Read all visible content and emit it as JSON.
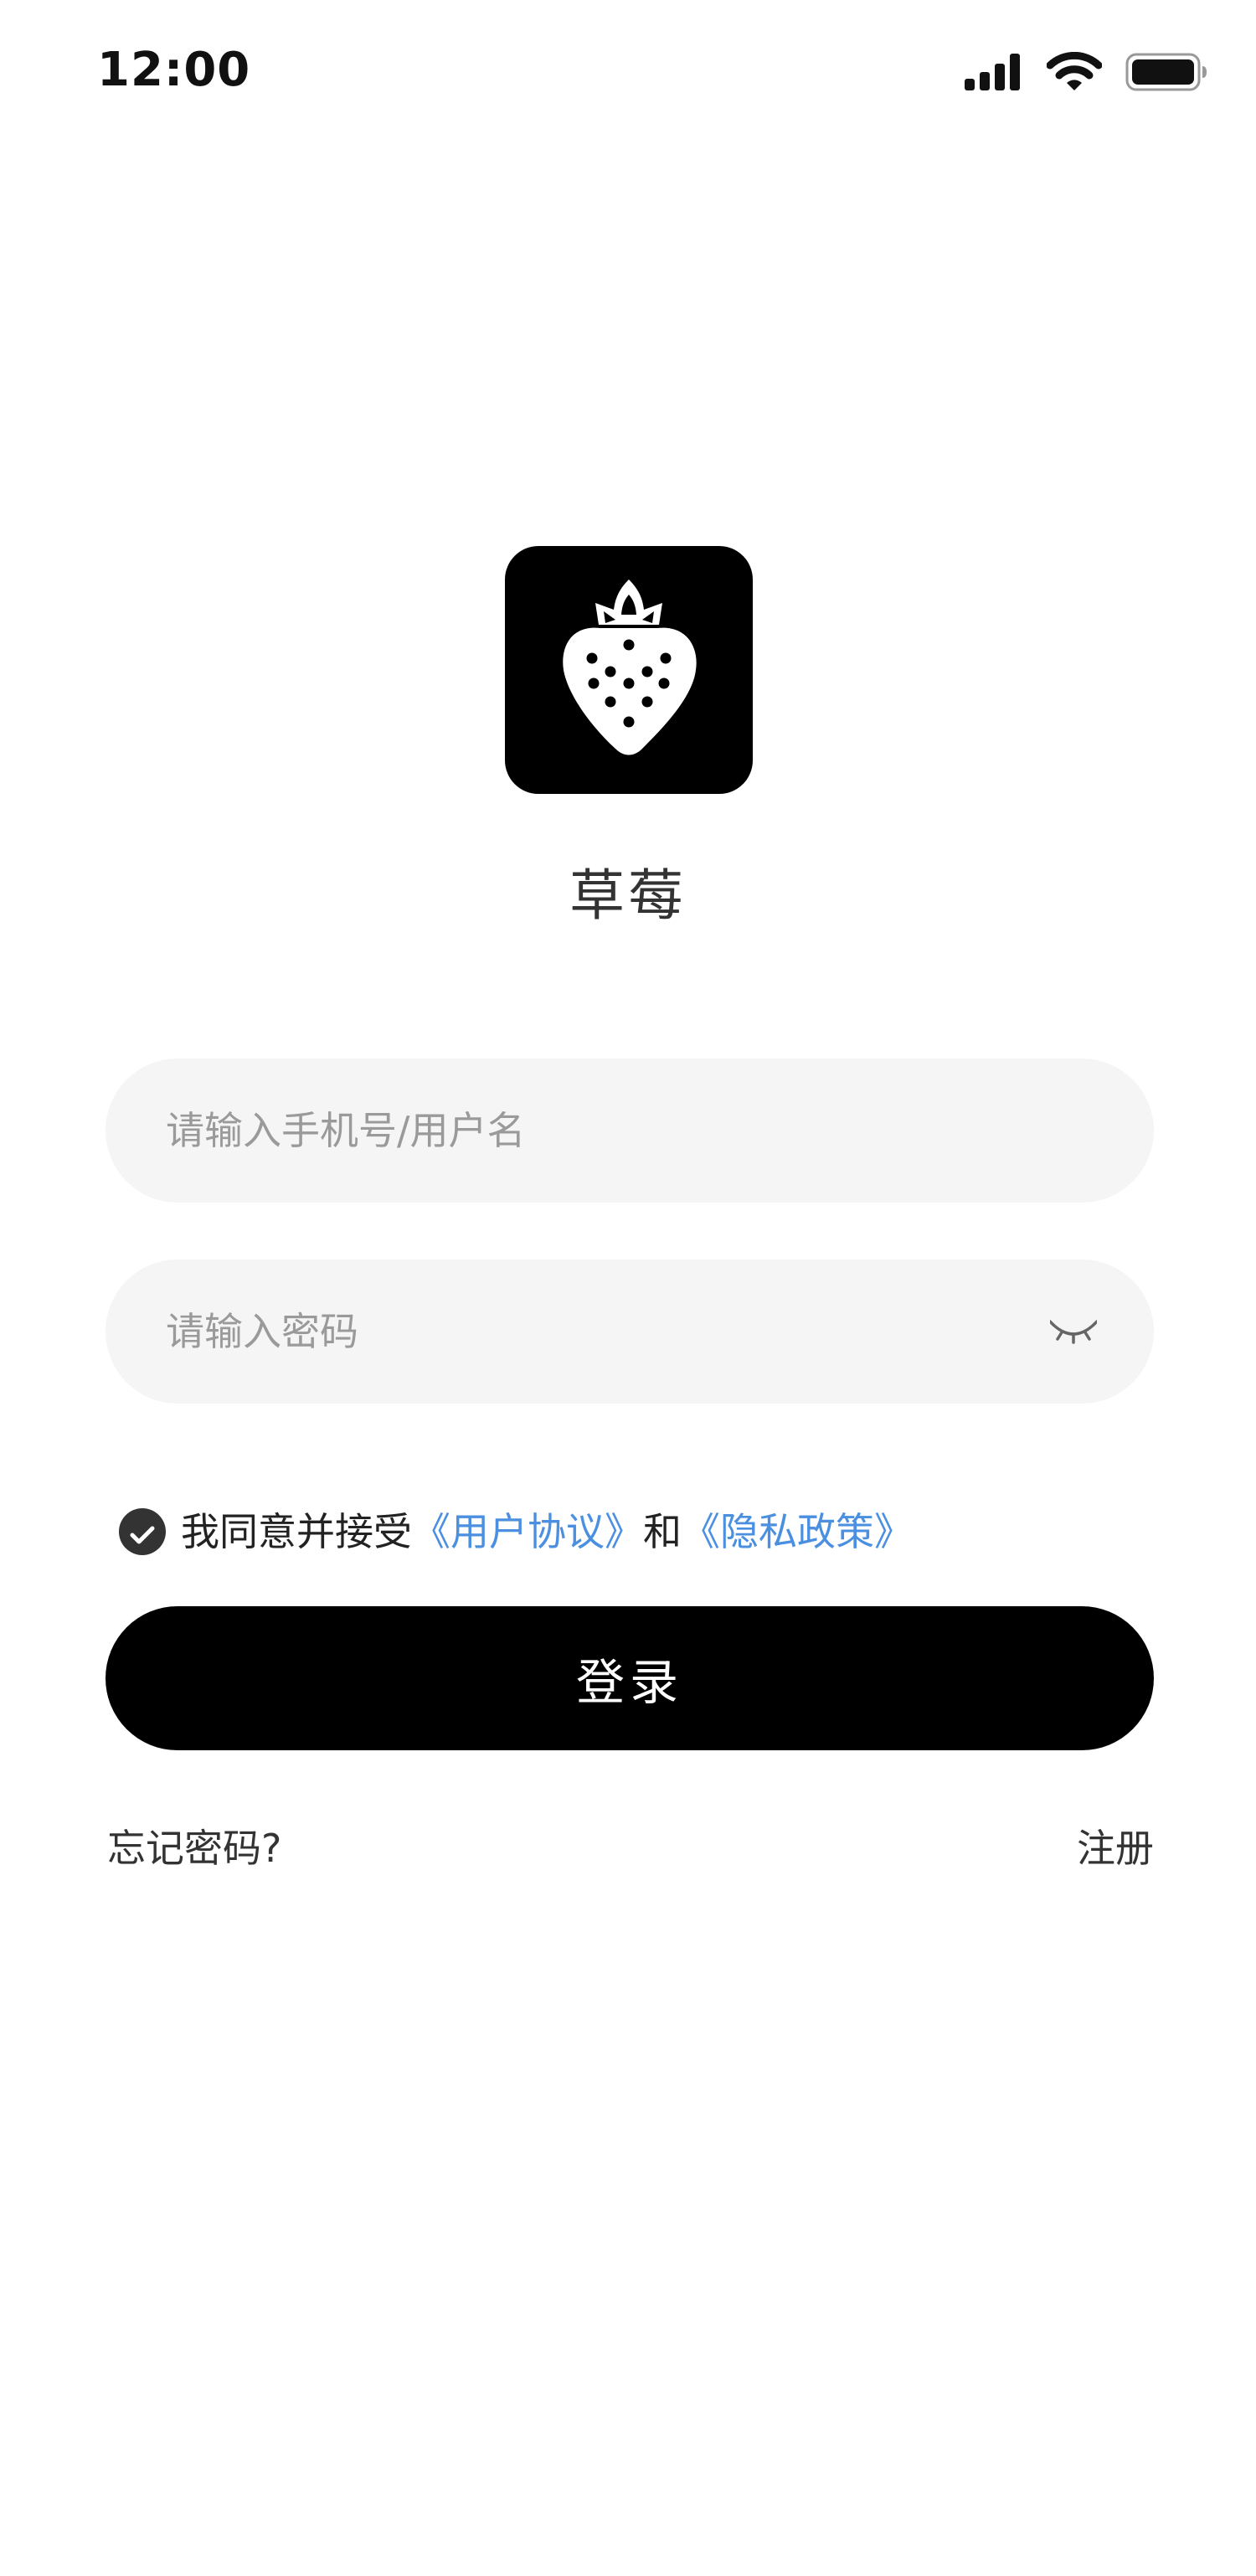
{
  "status_bar": {
    "time": "12:00",
    "icons": [
      "cellular-signal-icon",
      "wifi-icon",
      "battery-icon"
    ]
  },
  "app": {
    "icon": "strawberry-icon",
    "name": "草莓"
  },
  "login_form": {
    "username_placeholder": "请输入手机号/用户名",
    "username_value": "",
    "password_placeholder": "请输入密码",
    "password_value": "",
    "password_toggle_icon": "eye-closed-icon",
    "agreement": {
      "checked": true,
      "prefix": "我同意并接受",
      "user_agreement_link": "《用户协议》",
      "conjunction": "和",
      "privacy_policy_link": "《隐私政策》"
    },
    "login_label": "登录",
    "forgot_password_label": "忘记密码?",
    "register_label": "注册"
  },
  "colors": {
    "primary": "#000000",
    "link": "#4a8fe0",
    "field_background": "#f5f5f5",
    "placeholder": "#9a9a9a",
    "checkbox": "#333333"
  }
}
